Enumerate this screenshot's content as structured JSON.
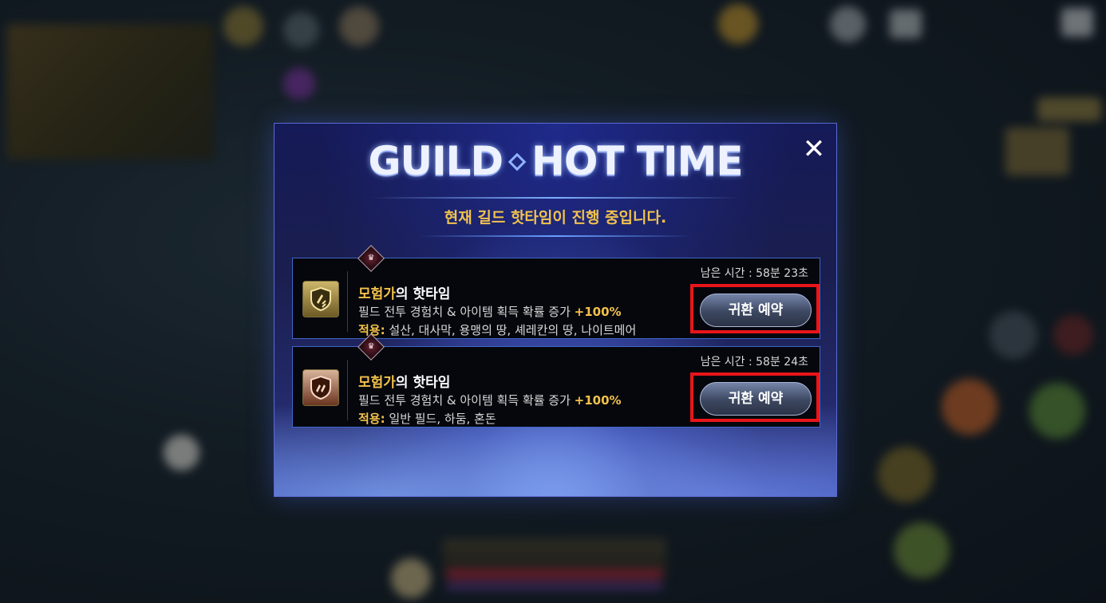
{
  "dialog": {
    "title_left": "GUILD",
    "title_right": "HOT TIME",
    "subtitle": "현재 길드 핫타임이 진행 중입니다.",
    "close_label": "✕"
  },
  "cards": [
    {
      "name_highlight": "모험가",
      "name_rest": "의 핫타임",
      "description": "필드 전투 경험치 & 아이템 획득 확률 증가",
      "bonus": "+100%",
      "apply_label": "적용:",
      "apply_value": "설산, 대사막, 용맹의 땅, 셰레칸의 땅, 나이트메어",
      "timer": "남은 시간 : 58분 23초",
      "button_label": "귀환 예약",
      "emblem": "shield-gold-icon"
    },
    {
      "name_highlight": "모험가",
      "name_rest": "의 핫타임",
      "description": "필드 전투 경험치 & 아이템 획득 확률 증가",
      "bonus": "+100%",
      "apply_label": "적용:",
      "apply_value": "일반 필드, 하둠, 혼돈",
      "timer": "남은 시간 : 58분 24초",
      "button_label": "귀환 예약",
      "emblem": "shield-bronze-icon"
    }
  ],
  "colors": {
    "accent_gold": "#f2c14a",
    "highlight_red": "#e8151b",
    "card_border": "#3f66c8"
  }
}
